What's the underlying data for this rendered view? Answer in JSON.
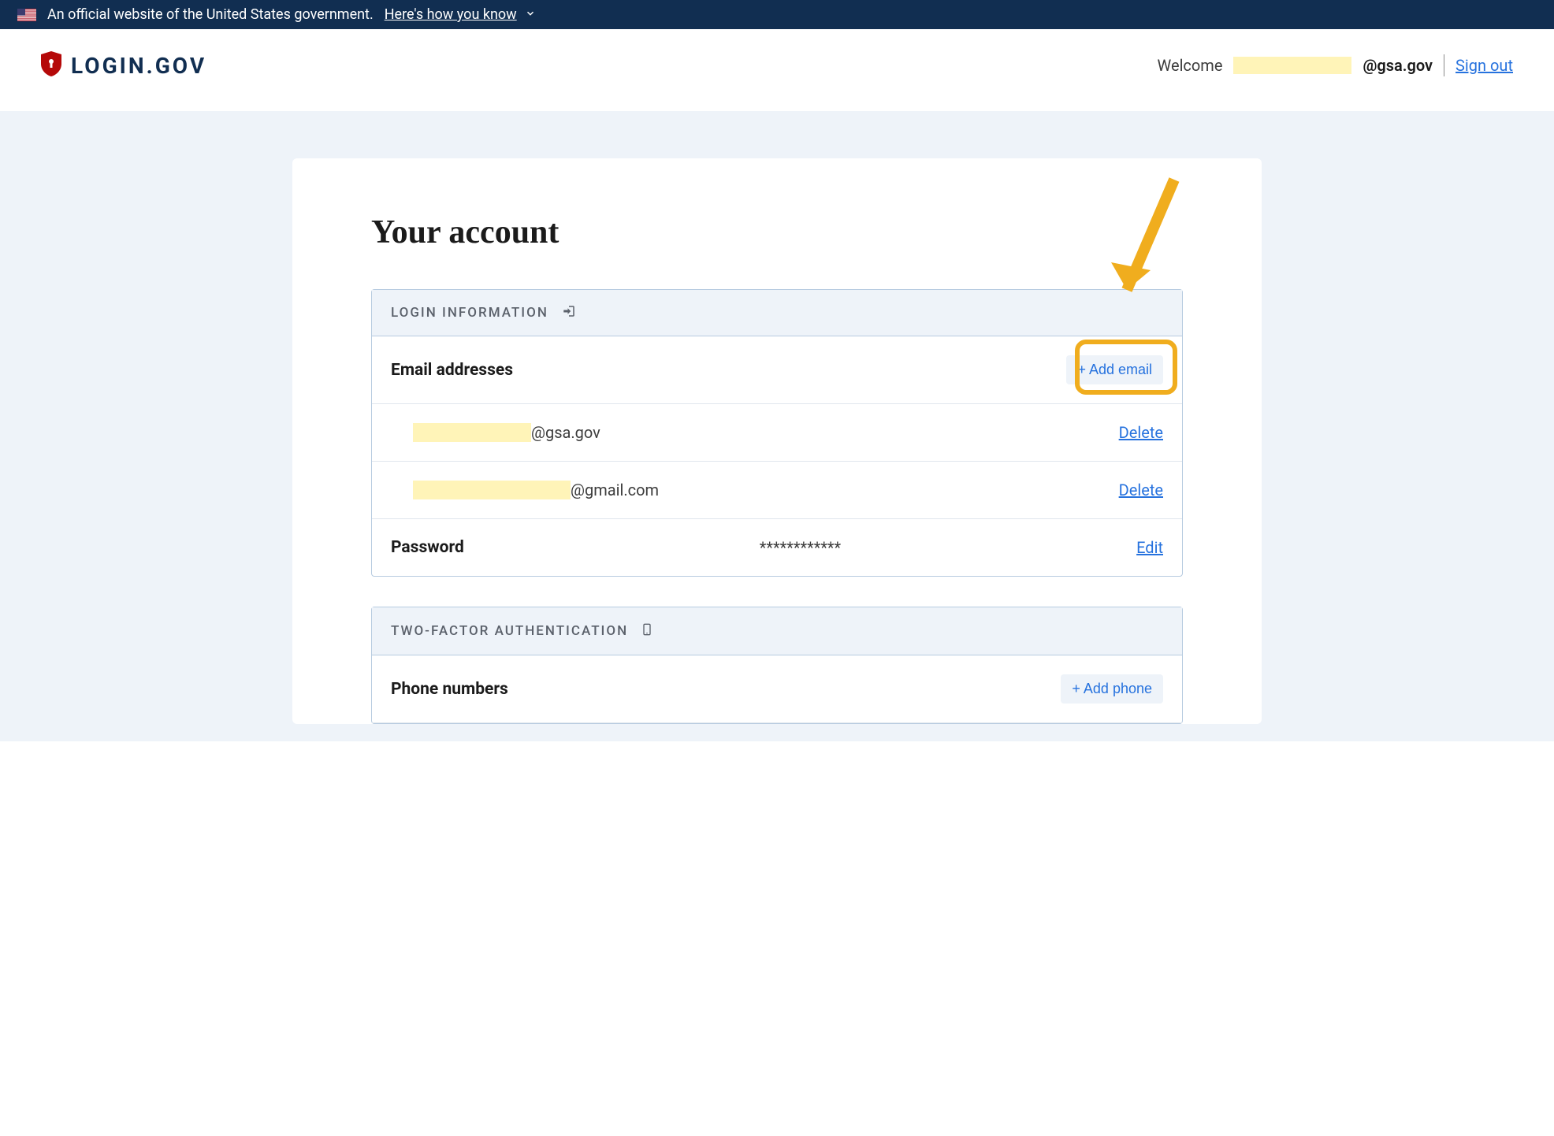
{
  "gov_banner": {
    "text": "An official website of the United States government.",
    "link": "Here's how you know"
  },
  "header": {
    "logo_text": "LOGIN.GOV",
    "welcome": "Welcome",
    "email_domain": "@gsa.gov",
    "signout": "Sign out"
  },
  "page": {
    "title": "Your account"
  },
  "login_info": {
    "header": "LOGIN INFORMATION",
    "emails_label": "Email addresses",
    "add_email": "+ Add email",
    "emails": [
      {
        "redacted_width": "w1",
        "domain": "@gsa.gov",
        "action": "Delete"
      },
      {
        "redacted_width": "w2",
        "domain": "@gmail.com",
        "action": "Delete"
      }
    ],
    "password_label": "Password",
    "password_masked": "************",
    "password_action": "Edit"
  },
  "two_factor": {
    "header": "TWO-FACTOR AUTHENTICATION",
    "phones_label": "Phone numbers",
    "add_phone": "+ Add phone"
  }
}
